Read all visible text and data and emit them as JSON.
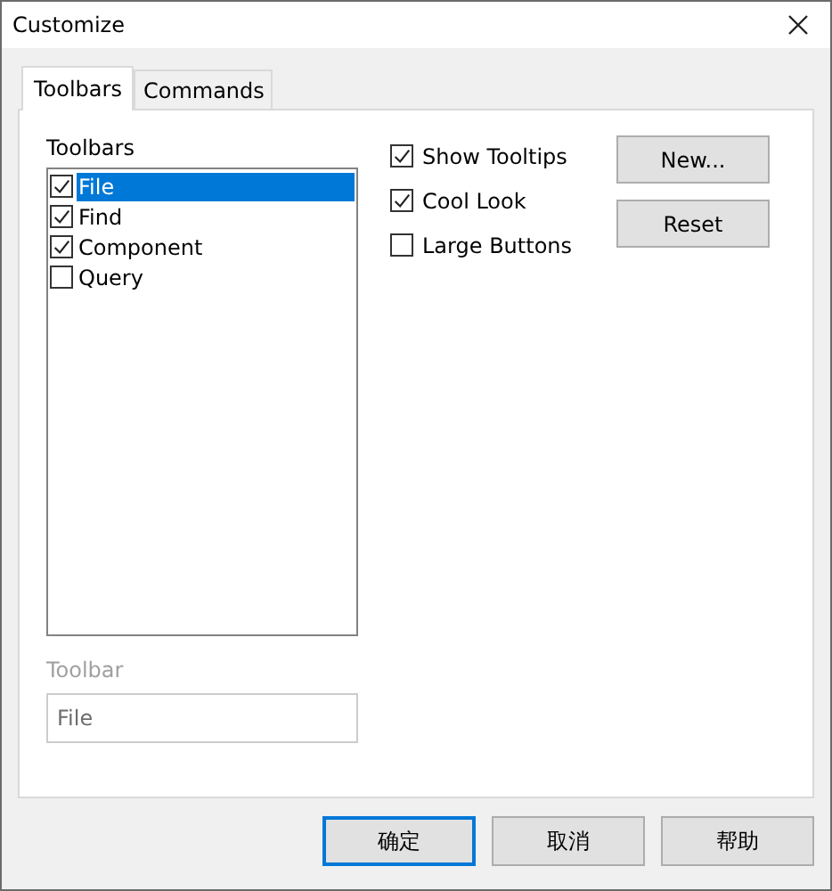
{
  "window": {
    "title": "Customize"
  },
  "tabs": [
    {
      "label": "Toolbars",
      "selected": true
    },
    {
      "label": "Commands",
      "selected": false
    }
  ],
  "toolbars_group": {
    "label": "Toolbars",
    "items": [
      {
        "label": "File",
        "checked": true,
        "selected": true
      },
      {
        "label": "Find",
        "checked": true,
        "selected": false
      },
      {
        "label": "Component",
        "checked": true,
        "selected": false
      },
      {
        "label": "Query",
        "checked": false,
        "selected": false
      }
    ]
  },
  "options": [
    {
      "label": "Show Tooltips",
      "checked": true
    },
    {
      "label": "Cool Look",
      "checked": true
    },
    {
      "label": "Large Buttons",
      "checked": false
    }
  ],
  "side_buttons": [
    "New...",
    "Reset"
  ],
  "toolbar_name": {
    "label": "Toolbar",
    "value": "File",
    "disabled": true
  },
  "buttons": [
    {
      "label": "确定",
      "default": true
    },
    {
      "label": "取消",
      "default": false
    },
    {
      "label": "帮助",
      "default": false
    }
  ]
}
